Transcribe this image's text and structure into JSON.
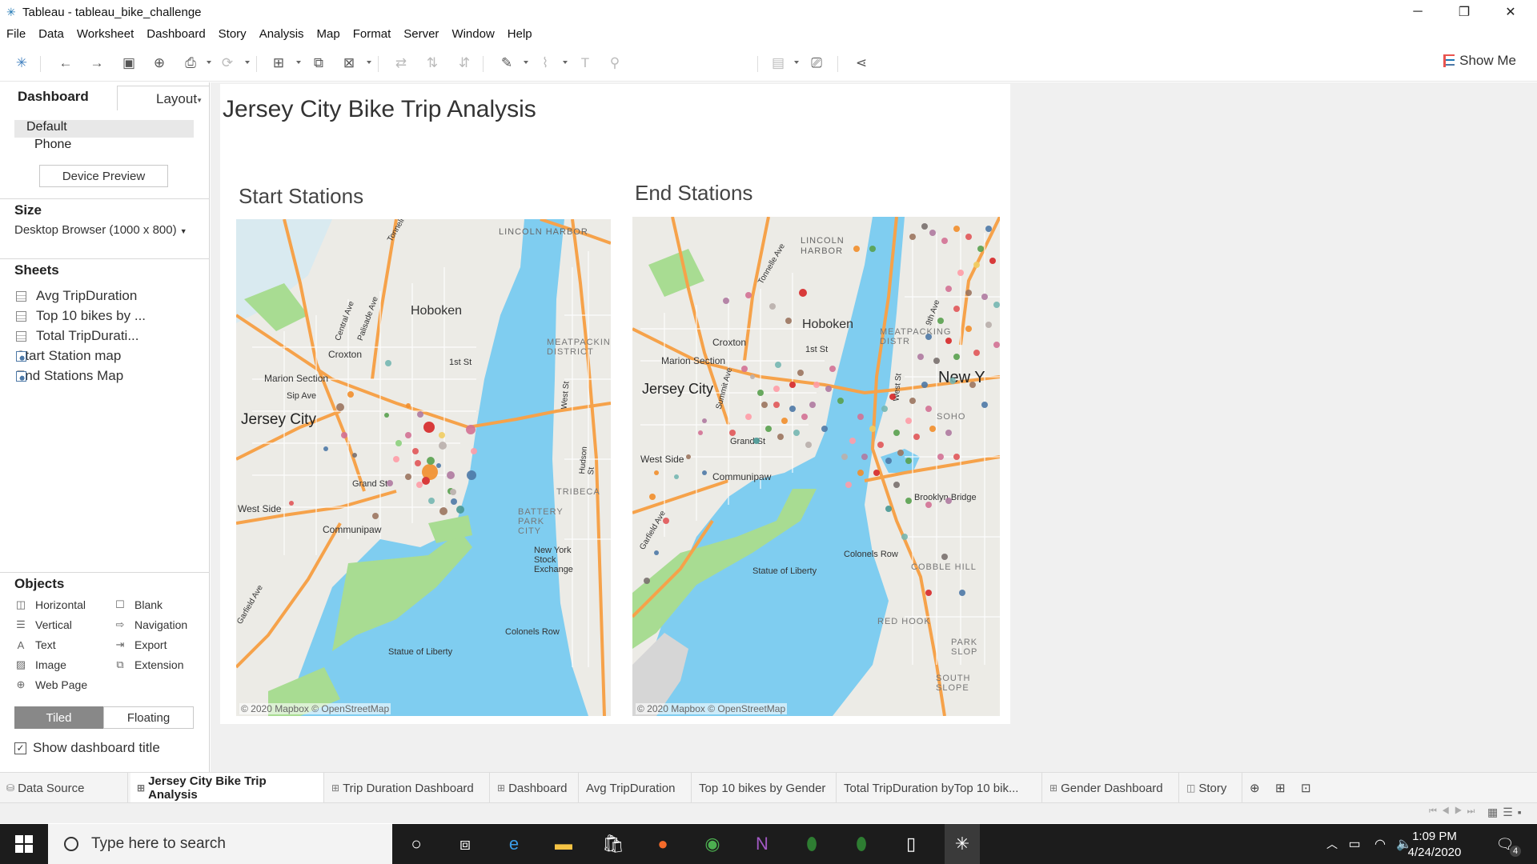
{
  "window": {
    "title": "Tableau - tableau_bike_challenge"
  },
  "menu": [
    "File",
    "Data",
    "Worksheet",
    "Dashboard",
    "Story",
    "Analysis",
    "Map",
    "Format",
    "Server",
    "Window",
    "Help"
  ],
  "toolbar": {
    "show_me": "Show Me"
  },
  "left_panel": {
    "tab_dashboard": "Dashboard",
    "tab_layout": "Layout",
    "device_default": "Default",
    "device_phone": "Phone",
    "device_preview": "Device Preview",
    "size_header": "Size",
    "size_value": "Desktop Browser (1000 x 800)",
    "sheets_header": "Sheets",
    "sheets": [
      "Avg TripDuration",
      "Top 10 bikes by ...",
      "Total TripDurati...",
      "Start Station map",
      "End Stations Map"
    ],
    "objects_header": "Objects",
    "objects": [
      "Horizontal",
      "Blank",
      "Vertical",
      "Navigation",
      "Text",
      "Export",
      "Image",
      "Extension",
      "Web Page"
    ],
    "tiled": "Tiled",
    "floating": "Floating",
    "show_title": "Show dashboard title"
  },
  "dashboard": {
    "title": "Jersey City Bike Trip Analysis",
    "start_title": "Start Stations",
    "end_title": "End Stations",
    "copyright": "© 2020 Mapbox © OpenStreetMap"
  },
  "maps": {
    "start_labels": [
      "LINCOLN HARBOR",
      "Hoboken",
      "1st St",
      "Croxton",
      "Marion Section",
      "Sip Ave",
      "Jersey City",
      "Grand St",
      "West Side",
      "Communipaw",
      "MEATPACKING DISTRICT",
      "TRIBECA",
      "BATTERY PARK CITY",
      "New York Stock Exchange",
      "Colonels Row",
      "Statue of Liberty",
      "Tonnelle Ave",
      "Palisade Ave",
      "Central Ave",
      "West St",
      "Hudson St",
      "Garfield Ave"
    ],
    "end_labels": [
      "LINCOLN HARBOR",
      "Hoboken",
      "1st St",
      "Croxton",
      "Marion Section",
      "Jersey City",
      "Grand St",
      "West Side",
      "Communipaw",
      "New Y",
      "Colonels Row",
      "Statue of Liberty",
      "RED HOOK",
      "PARK SLOP",
      "SOUTH SLOPE",
      "COBBLE HILL",
      "Brooklyn Bridge",
      "MEATPACKING DISTR",
      "SOHO",
      "Tonnelle Ave",
      "Summit Ave",
      "West St",
      "Garfield Ave",
      "9th Ave"
    ]
  },
  "bottom_tabs": [
    "Data Source",
    "Jersey City Bike Trip Analysis",
    "Trip Duration Dashboard",
    "Dashboard",
    "Avg TripDuration",
    "Top 10 bikes by Gender",
    "Total TripDuration byTop 10 bik...",
    "Gender Dashboard",
    "Story"
  ],
  "taskbar": {
    "search": "Type here to search",
    "time": "1:09 PM",
    "date": "4/24/2020",
    "notifications": "4"
  }
}
